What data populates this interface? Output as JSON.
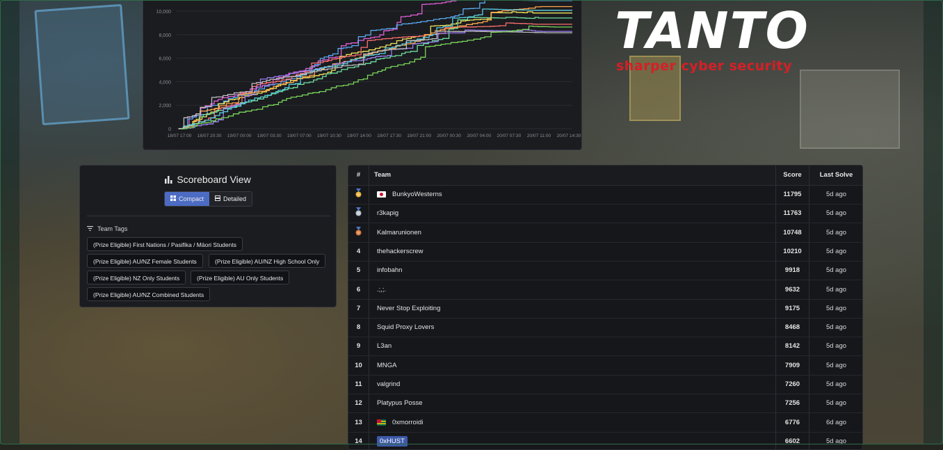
{
  "chart": {
    "y_ticks": [
      "10,000",
      "8,000",
      "6,000",
      "4,000",
      "2,000",
      "0"
    ],
    "x_ticks": [
      "18/07 17:00",
      "18/07 20:30",
      "19/07 00:00",
      "19/07 03:30",
      "19/07 07:00",
      "19/07 10:30",
      "19/07 14:00",
      "19/07 17:30",
      "19/07 21:00",
      "20/07 00:30",
      "20/07 04:00",
      "20/07 07:30",
      "20/07 11:00",
      "20/07 14:30"
    ],
    "series_colors": [
      "#e05fd6",
      "#5aa9f0",
      "#f0e35a",
      "#ff6e6e",
      "#6ee0a0",
      "#ffa64d",
      "#9a7cf0",
      "#5ad0e0",
      "#c0c0c0",
      "#7ad65a"
    ]
  },
  "logo": {
    "word": "TANTO",
    "tagline": "sharper cyber security"
  },
  "scoreboard_view": {
    "title": "Scoreboard View",
    "compact_label": "Compact",
    "detailed_label": "Detailed",
    "team_tags_label": "Team Tags",
    "tags": [
      "(Prize Eligible) First Nations / Pasifika / Māori Students",
      "(Prize Eligible) AU/NZ Female Students",
      "(Prize Eligible) AU/NZ High School Only",
      "(Prize Eligible) NZ Only Students",
      "(Prize Eligible) AU Only Students",
      "(Prize Eligible) AU/NZ Combined Students"
    ]
  },
  "table": {
    "headers": {
      "rank": "#",
      "team": "Team",
      "score": "Score",
      "last": "Last Solve"
    },
    "rows": [
      {
        "rank": "",
        "medal": "gold",
        "flag": "jp",
        "team": "BunkyoWesterns",
        "score": "11795",
        "last": "5d ago"
      },
      {
        "rank": "",
        "medal": "silver",
        "flag": "",
        "team": "r3kapig",
        "score": "11763",
        "last": "5d ago"
      },
      {
        "rank": "",
        "medal": "bronze",
        "flag": "",
        "team": "Kalmarunionen",
        "score": "10748",
        "last": "5d ago"
      },
      {
        "rank": "4",
        "medal": "",
        "flag": "",
        "team": "thehackerscrew",
        "score": "10210",
        "last": "5d ago"
      },
      {
        "rank": "5",
        "medal": "",
        "flag": "",
        "team": "infobahn",
        "score": "9918",
        "last": "5d ago"
      },
      {
        "rank": "6",
        "medal": "",
        "flag": "",
        "team": ".;,;.",
        "score": "9632",
        "last": "5d ago"
      },
      {
        "rank": "7",
        "medal": "",
        "flag": "",
        "team": "Never Stop Exploiting",
        "score": "9175",
        "last": "5d ago"
      },
      {
        "rank": "8",
        "medal": "",
        "flag": "",
        "team": "Squid Proxy Lovers",
        "score": "8468",
        "last": "5d ago"
      },
      {
        "rank": "9",
        "medal": "",
        "flag": "",
        "team": "L3an",
        "score": "8142",
        "last": "5d ago"
      },
      {
        "rank": "10",
        "medal": "",
        "flag": "",
        "team": "MNGA",
        "score": "7909",
        "last": "5d ago"
      },
      {
        "rank": "11",
        "medal": "",
        "flag": "",
        "team": "valgrind",
        "score": "7260",
        "last": "5d ago"
      },
      {
        "rank": "12",
        "medal": "",
        "flag": "",
        "team": "Platypus Posse",
        "score": "7256",
        "last": "5d ago"
      },
      {
        "rank": "13",
        "medal": "",
        "flag": "tg",
        "team": "0xmorroidi",
        "score": "6776",
        "last": "6d ago"
      },
      {
        "rank": "14",
        "medal": "",
        "flag": "",
        "team": "0xHUST",
        "score": "6602",
        "last": "5d ago",
        "highlight": true
      }
    ]
  }
}
